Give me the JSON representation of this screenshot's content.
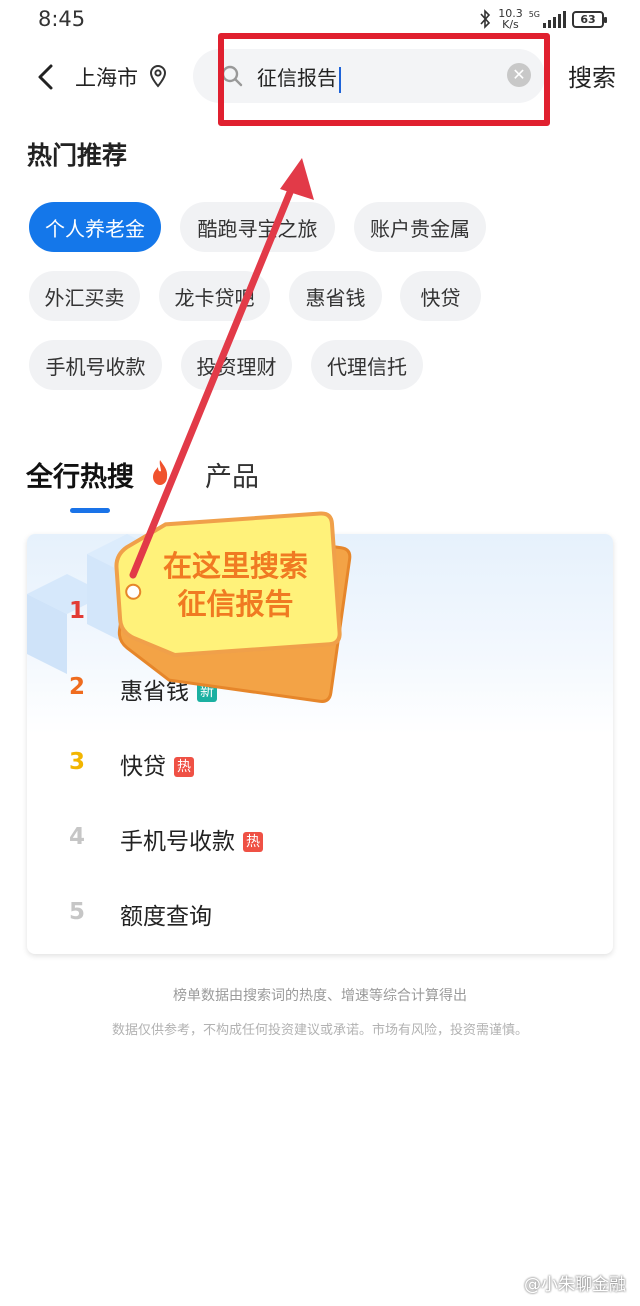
{
  "status_bar": {
    "time": "8:45",
    "speed_value": "10.3",
    "speed_unit": "K/s",
    "network": "5G",
    "battery": "63"
  },
  "header": {
    "city": "上海市",
    "search_value": "征信报告",
    "search_button": "搜索"
  },
  "hot": {
    "title": "热门推荐",
    "chips": [
      "个人养老金",
      "酷跑寻宝之旅",
      "账户贵金属",
      "外汇买卖",
      "龙卡贷吧",
      "惠省钱",
      "快贷",
      "手机号收款",
      "投资理财",
      "代理信托"
    ]
  },
  "tabs": {
    "active": "全行热搜",
    "other": "产品"
  },
  "ranking": [
    {
      "num": "1",
      "text": "",
      "badge": "",
      "color": "#e23b35"
    },
    {
      "num": "2",
      "text": "惠省钱",
      "badge": "新",
      "color": "#ef6c1f"
    },
    {
      "num": "3",
      "text": "快贷",
      "badge": "热",
      "color": "#f2b500"
    },
    {
      "num": "4",
      "text": "手机号收款",
      "badge": "热",
      "color": "#c6c6c6"
    },
    {
      "num": "5",
      "text": "额度查询",
      "badge": "",
      "color": "#c6c6c6"
    }
  ],
  "notes": {
    "line1": "榜单数据由搜索词的热度、增速等综合计算得出",
    "line2": "数据仅供参考，不构成任何投资建议或承诺。市场有风险，投资需谨慎。"
  },
  "annotation": {
    "line1": "在这里搜索",
    "line2": "征信报告"
  },
  "watermark": "@小朱聊金融",
  "colors": {
    "accent": "#1477ea",
    "annotation_red": "#e0202f",
    "tag_yellow": "#fff27a",
    "tag_orange": "#f09a3a"
  }
}
